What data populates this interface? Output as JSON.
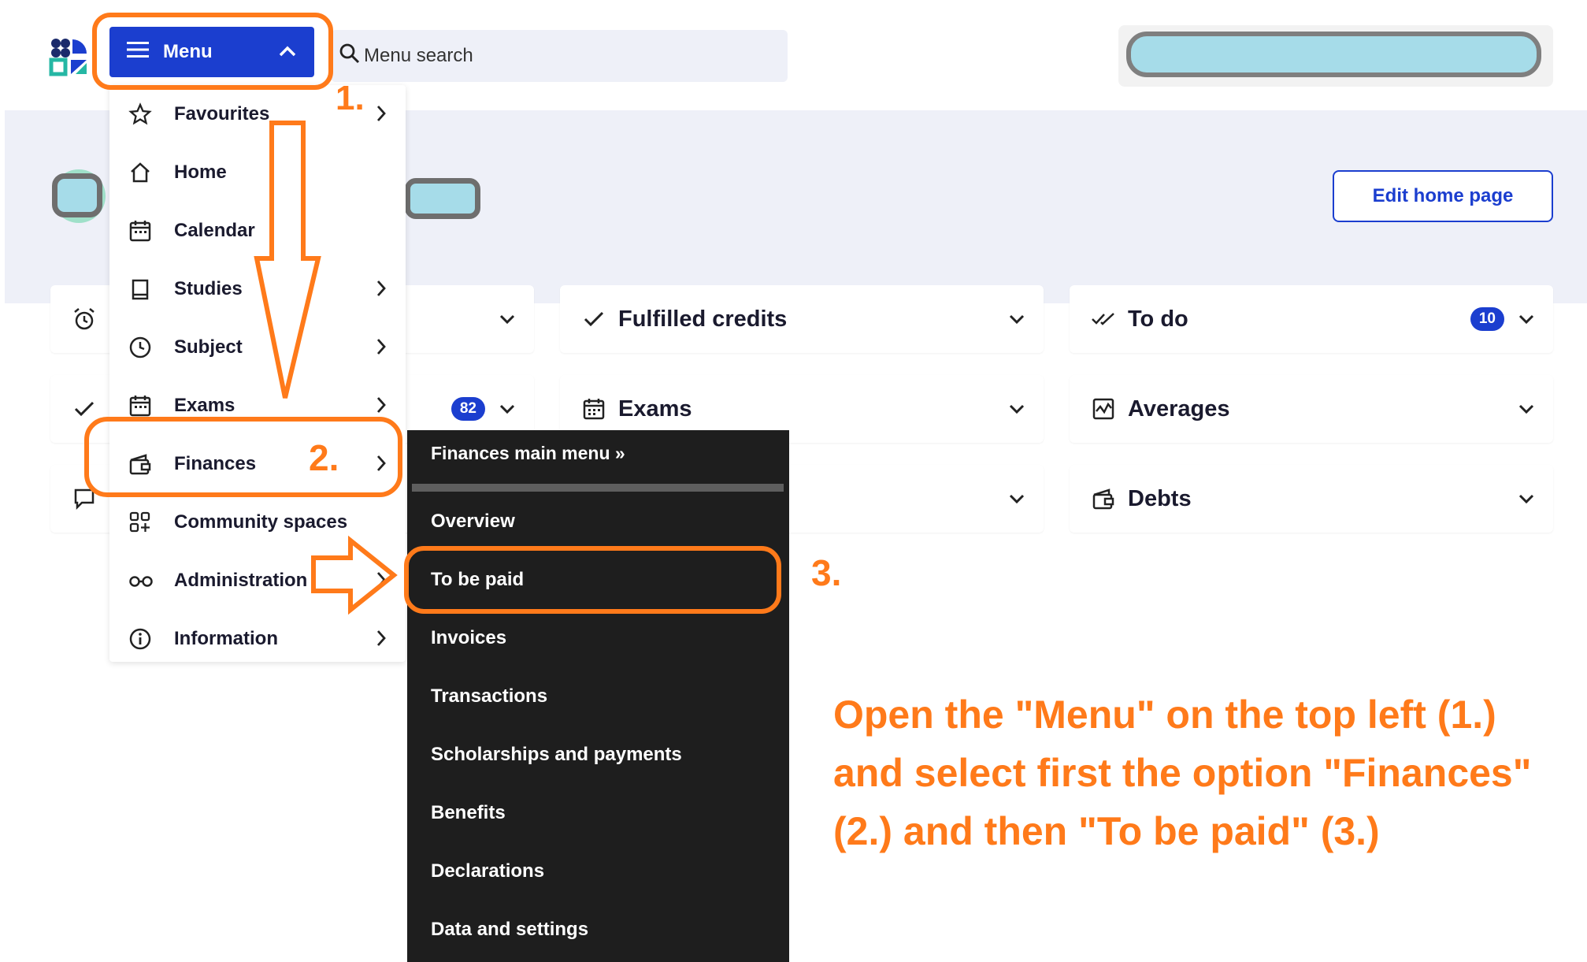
{
  "header": {
    "menu_label": "Menu",
    "search_placeholder": "Menu search"
  },
  "home": {
    "edit_button": "Edit home page"
  },
  "cards": [
    {
      "id": "fulfilled-credits",
      "title": "Fulfilled credits",
      "icon": "check-icon"
    },
    {
      "id": "to-do",
      "title": "To do",
      "icon": "double-check-icon",
      "badge": "10"
    },
    {
      "id": "exams",
      "title": "Exams",
      "icon": "calendar-icon"
    },
    {
      "id": "averages",
      "title": "Averages",
      "icon": "chart-icon"
    },
    {
      "id": "debts",
      "title": "Debts",
      "icon": "wallet-icon"
    },
    {
      "id": "hidden-card-badge",
      "badge": "82"
    }
  ],
  "menu": {
    "items": [
      {
        "label": "Favourites",
        "icon": "star-icon",
        "has_submenu": true
      },
      {
        "label": "Home",
        "icon": "home-icon",
        "has_submenu": false
      },
      {
        "label": "Calendar",
        "icon": "calendar-icon",
        "has_submenu": false
      },
      {
        "label": "Studies",
        "icon": "book-icon",
        "has_submenu": true
      },
      {
        "label": "Subject",
        "icon": "clock-icon",
        "has_submenu": true
      },
      {
        "label": "Exams",
        "icon": "calendar-icon",
        "has_submenu": true
      },
      {
        "label": "Finances",
        "icon": "wallet-icon",
        "has_submenu": true
      },
      {
        "label": "Community spaces",
        "icon": "grid-plus-icon",
        "has_submenu": false
      },
      {
        "label": "Administration",
        "icon": "glasses-icon",
        "has_submenu": true
      },
      {
        "label": "Information",
        "icon": "info-icon",
        "has_submenu": true
      }
    ]
  },
  "finances_submenu": {
    "header": "Finances main menu »",
    "items": [
      "Overview",
      "To be paid",
      "Invoices",
      "Transactions",
      "Scholarships and payments",
      "Benefits",
      "Declarations",
      "Data and settings"
    ]
  },
  "annotations": {
    "step1": "1.",
    "step2": "2.",
    "step3": "3.",
    "instruction_lines": [
      "Open the \"Menu\" on the top left (1.)",
      "and select first the option \"Finances\"",
      "(2.) and then \"To be paid\" (3.)"
    ]
  },
  "colors": {
    "primary": "#1b3ecf",
    "annotation_orange": "#ff7a1a",
    "submenu_bg": "#1e1e1e",
    "page_band": "#eef0f8",
    "redaction": "#a6dce9"
  }
}
